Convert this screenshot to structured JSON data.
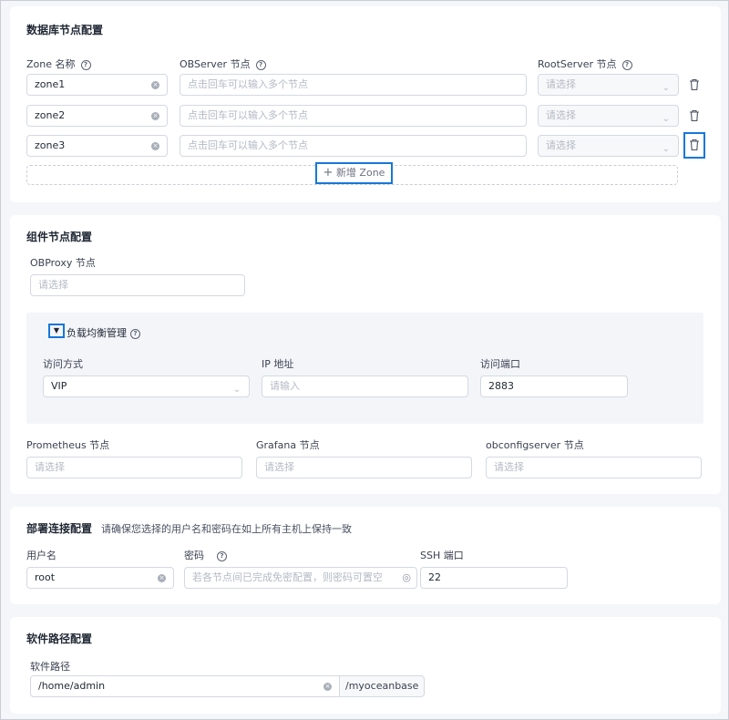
{
  "db_nodes": {
    "title": "数据库节点配置",
    "col_zone": "Zone 名称",
    "col_observer": "OBServer 节点",
    "col_rootserver": "RootServer 节点",
    "observer_placeholder": "点击回车可以输入多个节点",
    "select_placeholder": "请选择",
    "zones": [
      {
        "name": "zone1"
      },
      {
        "name": "zone2"
      },
      {
        "name": "zone3"
      }
    ],
    "add_zone_label": "新增 Zone"
  },
  "components": {
    "title": "组件节点配置",
    "obproxy_label": "OBProxy 节点",
    "obproxy_placeholder": "请选择",
    "lb_title": "负载均衡管理",
    "access_method_label": "访问方式",
    "access_method_value": "VIP",
    "ip_label": "IP 地址",
    "ip_placeholder": "请输入",
    "port_label": "访问端口",
    "port_value": "2883",
    "prometheus_label": "Prometheus 节点",
    "grafana_label": "Grafana 节点",
    "obconfig_label": "obconfigserver 节点",
    "select_placeholder": "请选择"
  },
  "deploy": {
    "title": "部署连接配置",
    "hint": "请确保您选择的用户名和密码在如上所有主机上保持一致",
    "user_label": "用户名",
    "user_value": "root",
    "password_label": "密码",
    "password_placeholder": "若各节点间已完成免密配置，则密码可置空",
    "ssh_label": "SSH 端口",
    "ssh_value": "22"
  },
  "software": {
    "title": "软件路径配置",
    "path_label": "软件路径",
    "path_value": "/home/admin",
    "path_suffix": "/myoceanbase"
  },
  "colors": {
    "accent": "#1677d9",
    "border": "#d4d9e1",
    "page_bg": "#f4f6fa"
  }
}
